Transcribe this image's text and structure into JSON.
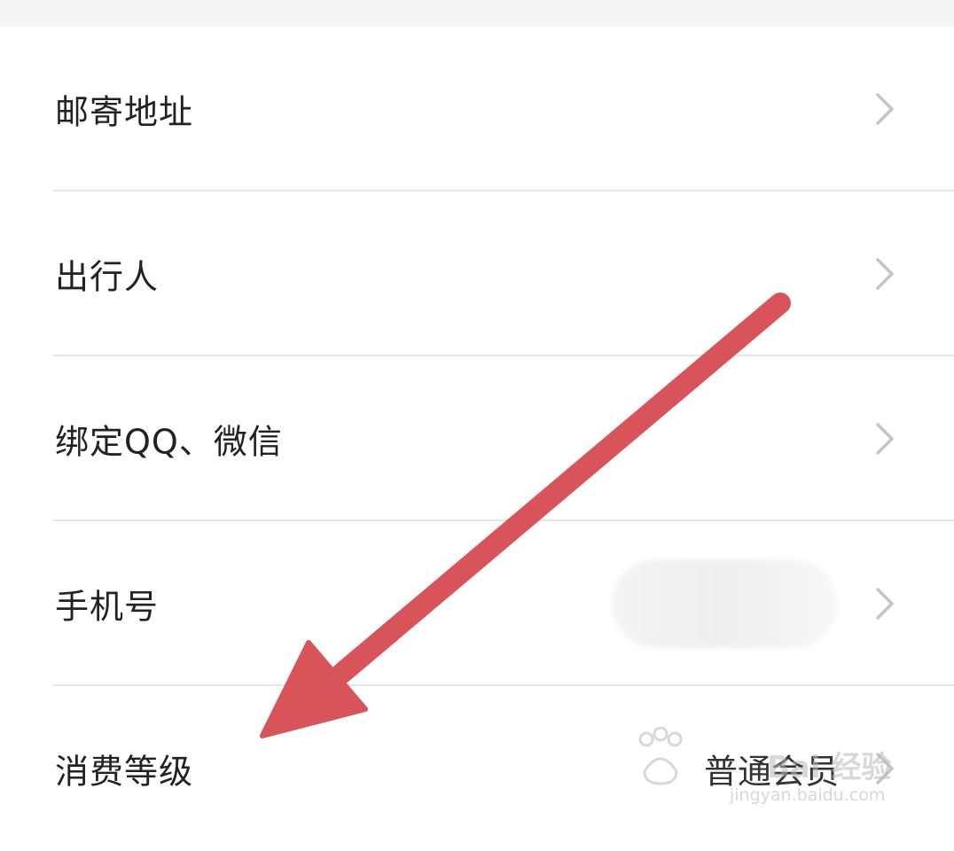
{
  "settings_list": {
    "items": [
      {
        "label": "邮寄地址",
        "value": ""
      },
      {
        "label": "出行人",
        "value": ""
      },
      {
        "label": "绑定QQ、微信",
        "value": ""
      },
      {
        "label": "手机号",
        "value": ""
      },
      {
        "label": "消费等级",
        "value": "普通会员"
      }
    ]
  },
  "watermark": {
    "brand": "Bai 经验",
    "url": "jingyan.baidu.com"
  },
  "annotation": {
    "arrow_color": "#d9535a",
    "arrow_icon": "red-arrow-annotation"
  },
  "icons": {
    "chevron": "chevron-right-icon"
  },
  "colors": {
    "label_text": "#222222",
    "divider": "#e6e6e6",
    "chevron": "#c4c4c4",
    "top_strip": "#f5f5f5"
  }
}
